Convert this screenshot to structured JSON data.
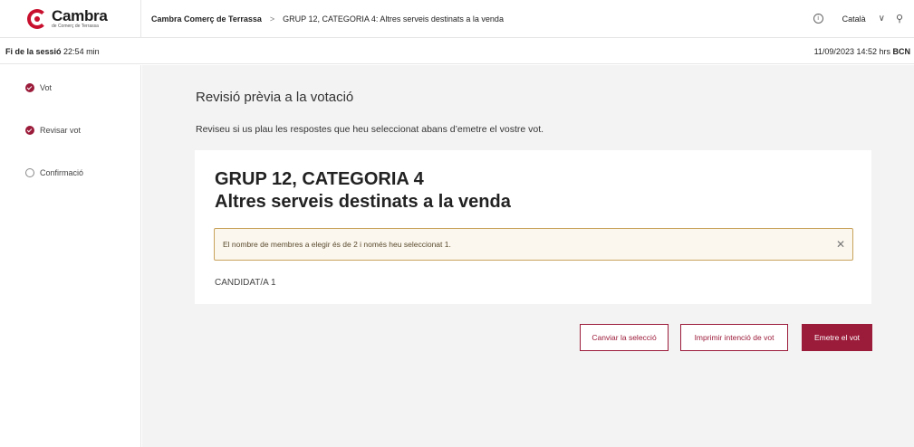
{
  "header": {
    "logo_main": "Cambra",
    "logo_sub": "de Comerç de Terrassa",
    "breadcrumb_root": "Cambra Comerç de Terrassa",
    "breadcrumb_sep": ">",
    "breadcrumb_current": "GRUP 12, CATEGORIA 4: Altres serveis destinats a la venda",
    "language": "Català",
    "info_icon": "info-icon",
    "user_icon": "user-icon"
  },
  "session": {
    "end_label": "Fi de la sessió",
    "remaining": "22:54 min",
    "datetime": "11/09/2023 14:52 hrs",
    "city": "BCN"
  },
  "steps": [
    {
      "label": "Vot",
      "state": "done"
    },
    {
      "label": "Revisar vot",
      "state": "done"
    },
    {
      "label": "Confirmació",
      "state": "pending"
    }
  ],
  "main": {
    "title": "Revisió prèvia a la votació",
    "subtitle": "Reviseu si us plau les respostes que heu seleccionat abans d’emetre el vostre vot.",
    "card": {
      "heading_line1": "GRUP 12, CATEGORIA 4",
      "heading_line2": "Altres serveis destinats a la venda",
      "alert_text": "El nombre de membres a elegir és de 2 i només heu seleccionat 1.",
      "candidate": "CANDIDAT/A 1"
    },
    "buttons": {
      "change": "Canviar la selecció",
      "print": "Imprimir intenció de vot",
      "submit": "Emetre el vot"
    }
  },
  "colors": {
    "brand": "#9b1b3a",
    "alert_bg": "#fbf7ee",
    "alert_border": "#c9a35c",
    "main_bg": "#f3f3f3"
  }
}
